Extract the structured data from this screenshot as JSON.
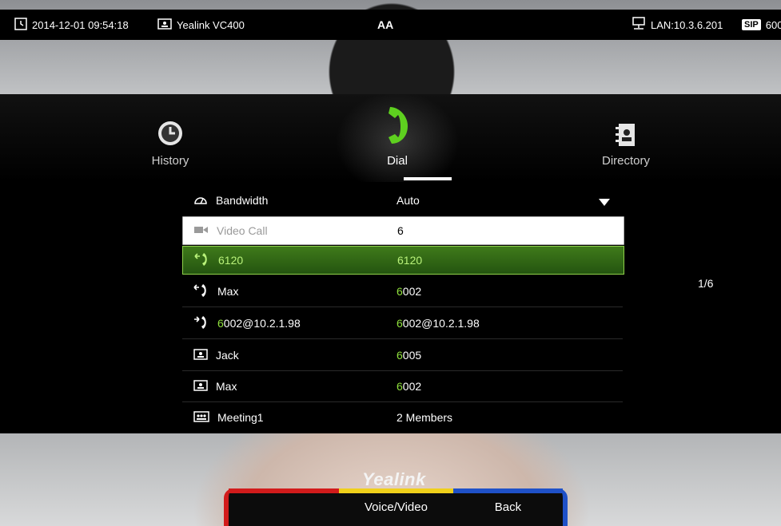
{
  "status_bar": {
    "datetime": "2014-12-01 09:54:18",
    "device_name": "Yealink VC400",
    "input_method": "AA",
    "lan": "LAN:10.3.6.201",
    "sip_badge": "SIP",
    "sip_account": "600"
  },
  "tabs": [
    {
      "label": "History",
      "icon": "clock-icon"
    },
    {
      "label": "Dial",
      "icon": "phone-icon",
      "active": true
    },
    {
      "label": "Directory",
      "icon": "contacts-book-icon"
    }
  ],
  "bandwidth": {
    "label": "Bandwidth",
    "value": "Auto"
  },
  "dial_input": {
    "placeholder": "Video Call",
    "value": "6"
  },
  "entries": [
    {
      "name": "6120",
      "name_match": "",
      "number_match": "6",
      "number_rest": "120",
      "icon": "missed-call-icon",
      "selected": true
    },
    {
      "name": "Max",
      "name_match": "",
      "number_match": "6",
      "number_rest": "002",
      "icon": "missed-call-icon"
    },
    {
      "name": "002@10.2.1.98",
      "name_match": "6",
      "number_match": "6",
      "number_rest": "002@10.2.1.98",
      "icon": "outgoing-call-icon"
    },
    {
      "name": "Jack",
      "name_match": "",
      "number_match": "6",
      "number_rest": "005",
      "icon": "contact-card-icon"
    },
    {
      "name": "Max",
      "name_match": "",
      "number_match": "6",
      "number_rest": "002",
      "icon": "contact-card-icon"
    },
    {
      "name": "Meeting1",
      "name_match": "",
      "number_match": "",
      "number_rest": "2 Members",
      "icon": "meeting-group-icon"
    }
  ],
  "page_indicator": "1/6",
  "brand": "Yealink",
  "softkeys": {
    "red": "",
    "yellow": "Voice/Video",
    "blue": "Back"
  },
  "colors": {
    "match_highlight": "#8fe03c",
    "selection": "#3f7a1a",
    "softkey_red": "#d21b1b",
    "softkey_yellow": "#f0d01a",
    "softkey_blue": "#1f51c8"
  }
}
